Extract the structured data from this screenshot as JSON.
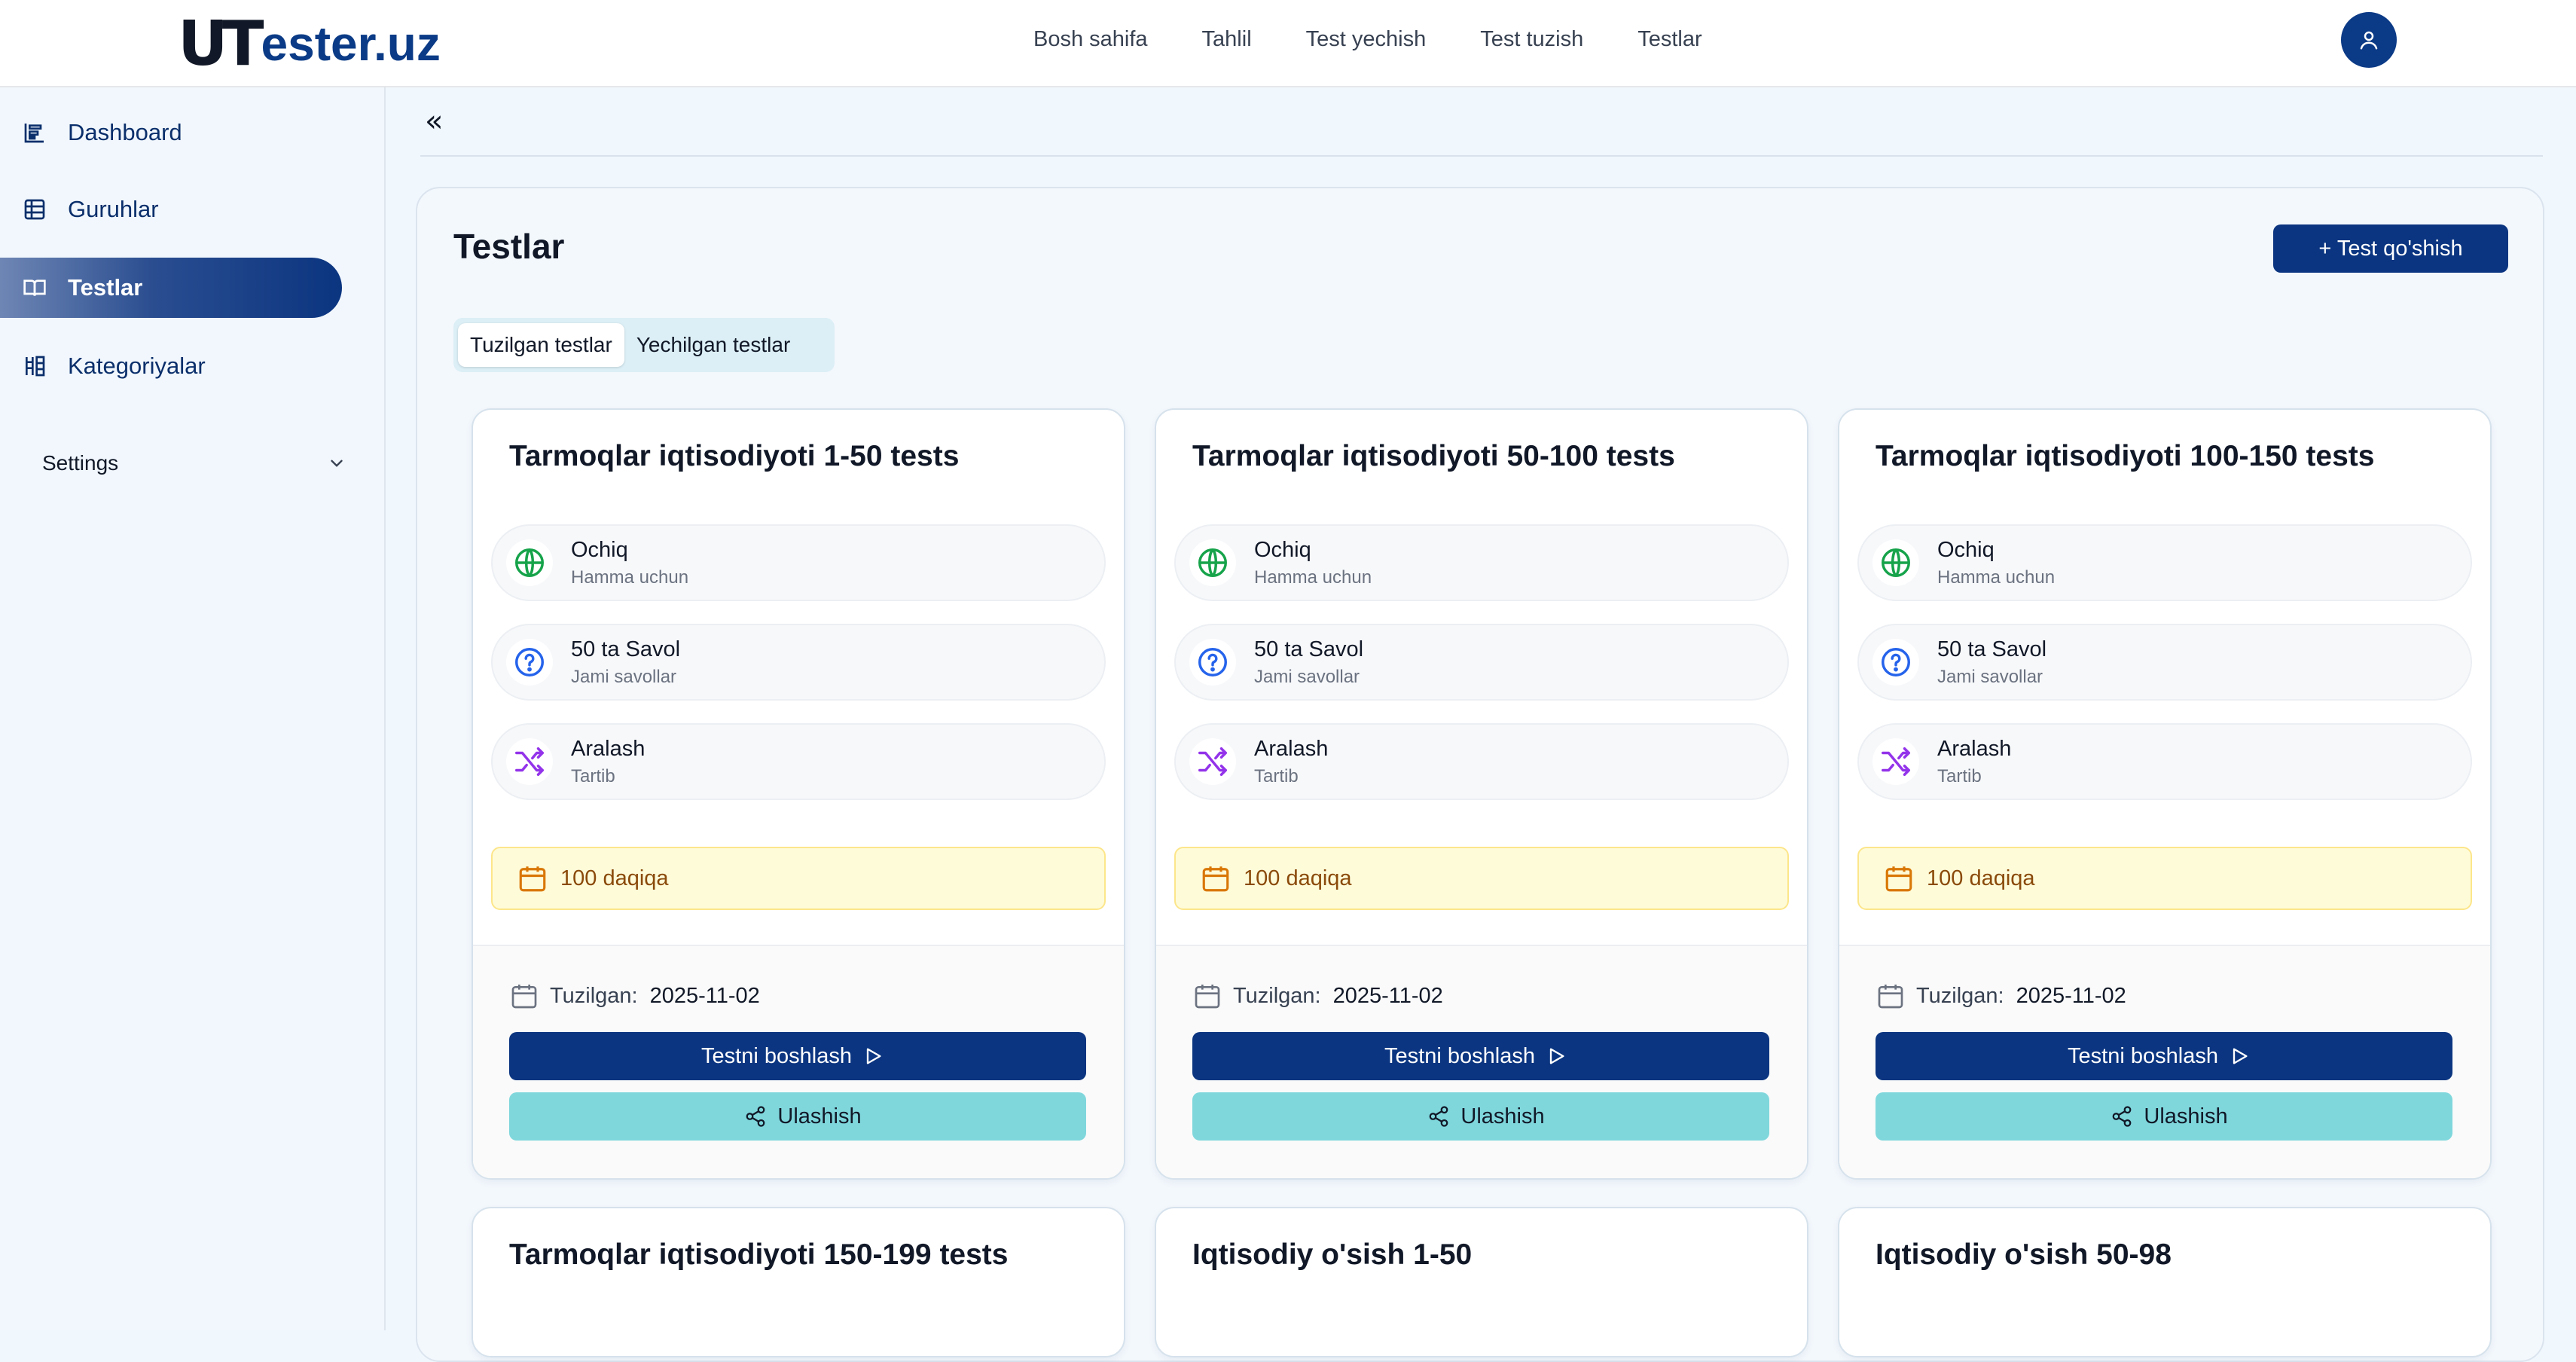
{
  "header": {
    "logo_mark": "UT",
    "logo_text": "ester.uz",
    "nav": [
      "Bosh sahifa",
      "Tahlil",
      "Test yechish",
      "Test tuzish",
      "Testlar"
    ]
  },
  "sidebar": {
    "items": [
      {
        "label": "Dashboard",
        "icon": "dashboard-icon"
      },
      {
        "label": "Guruhlar",
        "icon": "table-icon"
      },
      {
        "label": "Testlar",
        "icon": "book-open-icon",
        "active": true
      },
      {
        "label": "Kategoriyalar",
        "icon": "columns-icon"
      }
    ],
    "settings_label": "Settings"
  },
  "main": {
    "collapse_symbol": "«",
    "title": "Testlar",
    "add_button": "+ Test qo'shish",
    "tabs": [
      "Tuzilgan testlar",
      "Yechilgan testlar"
    ]
  },
  "labels": {
    "access": "Ochiq",
    "access_sub": "Hamma uchun",
    "questions_sub": "Jami savollar",
    "order": "Aralash",
    "order_sub": "Tartib",
    "created": "Tuzilgan:",
    "start": "Testni boshlash",
    "share": "Ulashish"
  },
  "tests": [
    {
      "title": "Tarmoqlar iqtisodiyoti 1-50 tests",
      "questions": "50 ta Savol",
      "duration": "100 daqiqa",
      "created_date": "2025-11-02"
    },
    {
      "title": "Tarmoqlar iqtisodiyoti 50-100 tests",
      "questions": "50 ta Savol",
      "duration": "100 daqiqa",
      "created_date": "2025-11-02"
    },
    {
      "title": "Tarmoqlar iqtisodiyoti 100-150 tests",
      "questions": "50 ta Savol",
      "duration": "100 daqiqa",
      "created_date": "2025-11-02"
    },
    {
      "title": "Tarmoqlar iqtisodiyoti 150-199 tests"
    },
    {
      "title": "Iqtisodiy o'sish 1-50"
    },
    {
      "title": "Iqtisodiy o'sish 50-98"
    }
  ],
  "colors": {
    "brand": "#0b3580",
    "share": "#7fd7dc",
    "globe": "#16a34a",
    "question": "#2563eb",
    "shuffle": "#9333ea",
    "duration": "#d97706"
  }
}
